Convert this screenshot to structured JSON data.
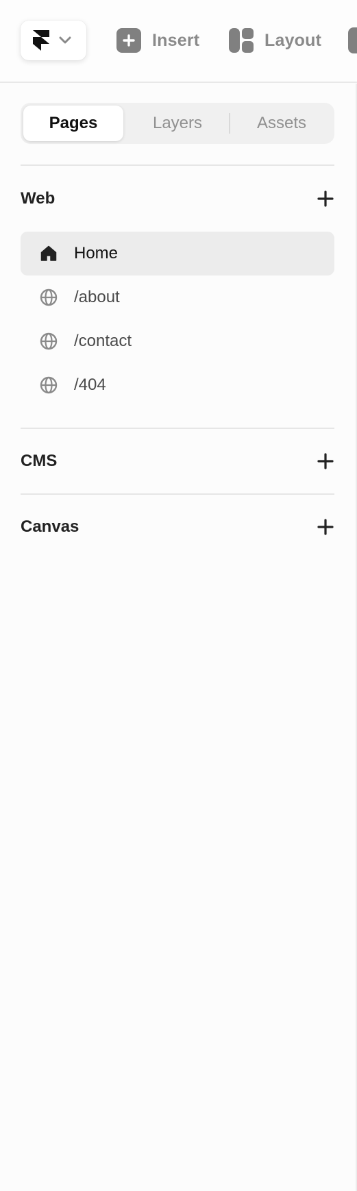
{
  "toolbar": {
    "logo_icon": "framer-logo-icon",
    "menu_icon": "chevron-down-icon",
    "insert_label": "Insert",
    "insert_icon": "plus-square-icon",
    "layout_label": "Layout",
    "layout_icon": "layout-icon"
  },
  "tabs": {
    "pages": "Pages",
    "layers": "Layers",
    "assets": "Assets",
    "active": "Pages"
  },
  "sections": {
    "web": {
      "title": "Web",
      "add_icon": "plus-icon",
      "pages": [
        {
          "label": "Home",
          "icon": "home-icon",
          "selected": true
        },
        {
          "label": "/about",
          "icon": "globe-icon",
          "selected": false
        },
        {
          "label": "/contact",
          "icon": "globe-icon",
          "selected": false
        },
        {
          "label": "/404",
          "icon": "globe-icon",
          "selected": false
        }
      ]
    },
    "cms": {
      "title": "CMS",
      "add_icon": "plus-icon"
    },
    "canvas": {
      "title": "Canvas",
      "add_icon": "plus-icon"
    }
  },
  "colors": {
    "background": "#fcfcfc",
    "selected_row": "#ececec",
    "segmented_bg": "#f0f0f0",
    "toolbar_icon": "#808080",
    "muted_text": "#8a8a8a"
  }
}
